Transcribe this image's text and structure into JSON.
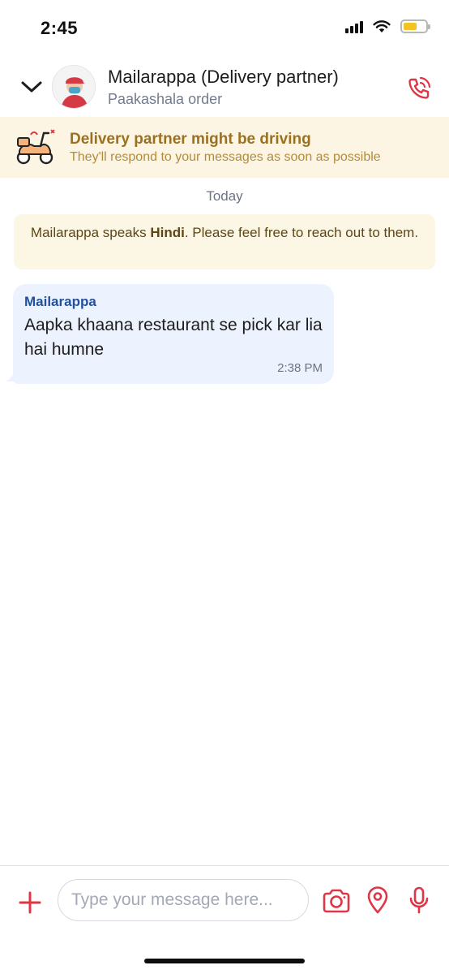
{
  "status_bar": {
    "time": "2:45",
    "battery_color": "#f3c421"
  },
  "header": {
    "back_icon": "chevron-down-icon",
    "contact_name": "Mailarappa (Delivery partner)",
    "subtitle": "Paakashala order",
    "call_icon": "phone-icon",
    "accent_color": "#e03546"
  },
  "driving_banner": {
    "icon": "scooter-icon",
    "title": "Delivery partner might be driving",
    "subtitle": "They'll respond to your messages as soon as possible",
    "background": "#fcf5e4"
  },
  "conversation": {
    "date_label": "Today",
    "info_note": {
      "prefix": "Mailarappa speaks ",
      "language": "Hindi",
      "suffix": ". Please feel free to reach out to them."
    },
    "messages": [
      {
        "sender": "Mailarappa",
        "text": "Aapka khaana restaurant se pick kar lia hai humne",
        "time": "2:38 PM"
      }
    ]
  },
  "composer": {
    "add_icon": "plus-icon",
    "input_placeholder": "Type your message here...",
    "input_value": "",
    "camera_icon": "camera-icon",
    "location_icon": "location-pin-icon",
    "mic_icon": "microphone-icon"
  }
}
